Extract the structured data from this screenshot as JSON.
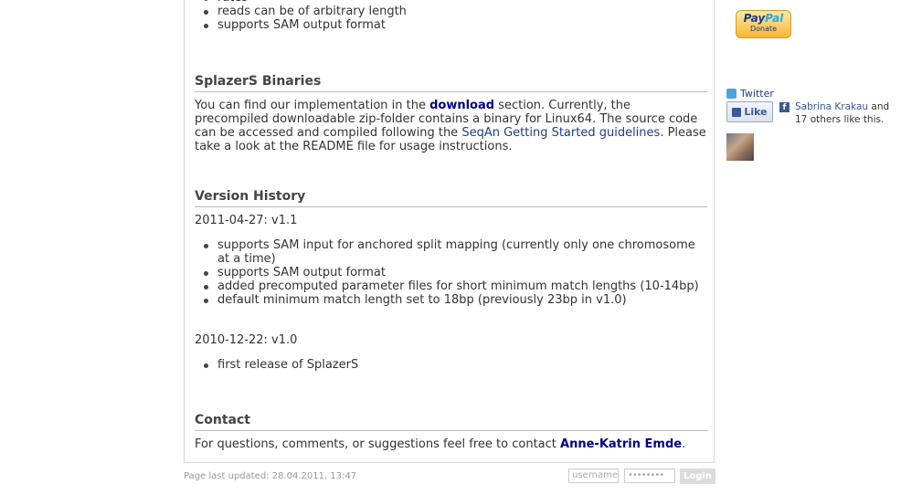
{
  "top_list": [
    "rates",
    "reads can be of arbitrary length",
    "supports SAM output format"
  ],
  "binaries": {
    "heading": "SplazerS Binaries",
    "p1": "You can find our implementation in the ",
    "download_link": "download",
    "p2": " section. Currently, the precompiled downloadable zip-folder contains a binary for Linux64. The source code can be accessed and compiled following the ",
    "seqan_link": "SeqAn Getting Started guidelines",
    "p3": ". Please take a look at the README file for usage instructions."
  },
  "history": {
    "heading": "Version History",
    "v11_date": "2011-04-27: v1.1",
    "v11_items": [
      "supports SAM input for anchored split mapping (currently only one chromosome at a time)",
      "supports SAM output format",
      "added precomputed parameter files for short minimum match lengths (10-14bp)",
      "default minimum match length set to 18bp (previously 23bp in v1.0)"
    ],
    "v10_date": "2010-12-22: v1.0",
    "v10_items": [
      "first release of SplazerS"
    ]
  },
  "contact": {
    "heading": "Contact",
    "text": "For questions, comments, or suggestions feel free to contact ",
    "author_link": "Anne-Katrin Emde",
    "end": "."
  },
  "footer": {
    "updated": "Page last updated: 28.04.2011, 13:47",
    "username_placeholder": "username",
    "password_placeholder": "••••••••",
    "login_label": "Login"
  },
  "sidebar": {
    "paypal_pay": "Pay",
    "paypal_pal": "Pal",
    "paypal_donate": "Donate",
    "twitter_label": "Twitter",
    "like_label": "Like",
    "fb_letter": "f",
    "fb_name": "Sabrina Krakau",
    "fb_rest": " and 17 others like this."
  }
}
